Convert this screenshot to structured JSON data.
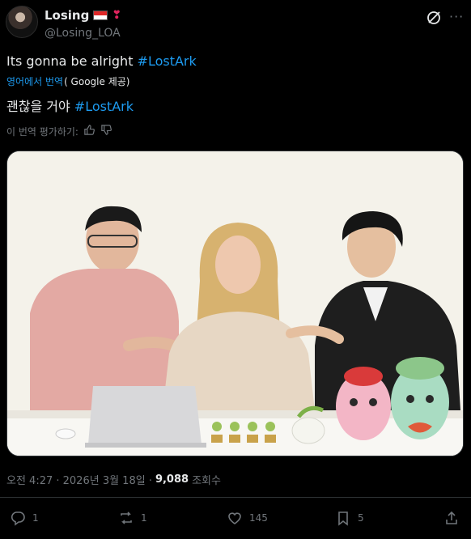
{
  "author": {
    "display_name": "Losing",
    "handle": "@Losing_LOA",
    "avatar_icon": "profile-avatar",
    "badges": [
      "flag-icon",
      "red-heart-icon"
    ]
  },
  "tweet": {
    "text": "Its gonna be alright ",
    "hashtag": "#LostArk",
    "translate_label": "영어에서 번역",
    "translate_provider": "( Google 제공)",
    "translated_text": "괜찮을 거야 ",
    "translated_hashtag": "#LostArk",
    "rate_label": "이 번역 평가하기:",
    "rate_icons": [
      "thumbs-up-icon",
      "thumbs-down-icon"
    ]
  },
  "meta": {
    "timestamp": "오전 4:27 · 2026년 3월 18일 · ",
    "views_count": "9,088",
    "views_label": "조회수"
  },
  "actions": {
    "reply_count": "1",
    "repost_count": "1",
    "like_count": "145",
    "bookmark_count": "5"
  },
  "colors": {
    "background": "#000000",
    "text": "#e7e9ea",
    "secondary": "#71767b",
    "link": "#1d9bf0",
    "divider": "#2f3336"
  }
}
